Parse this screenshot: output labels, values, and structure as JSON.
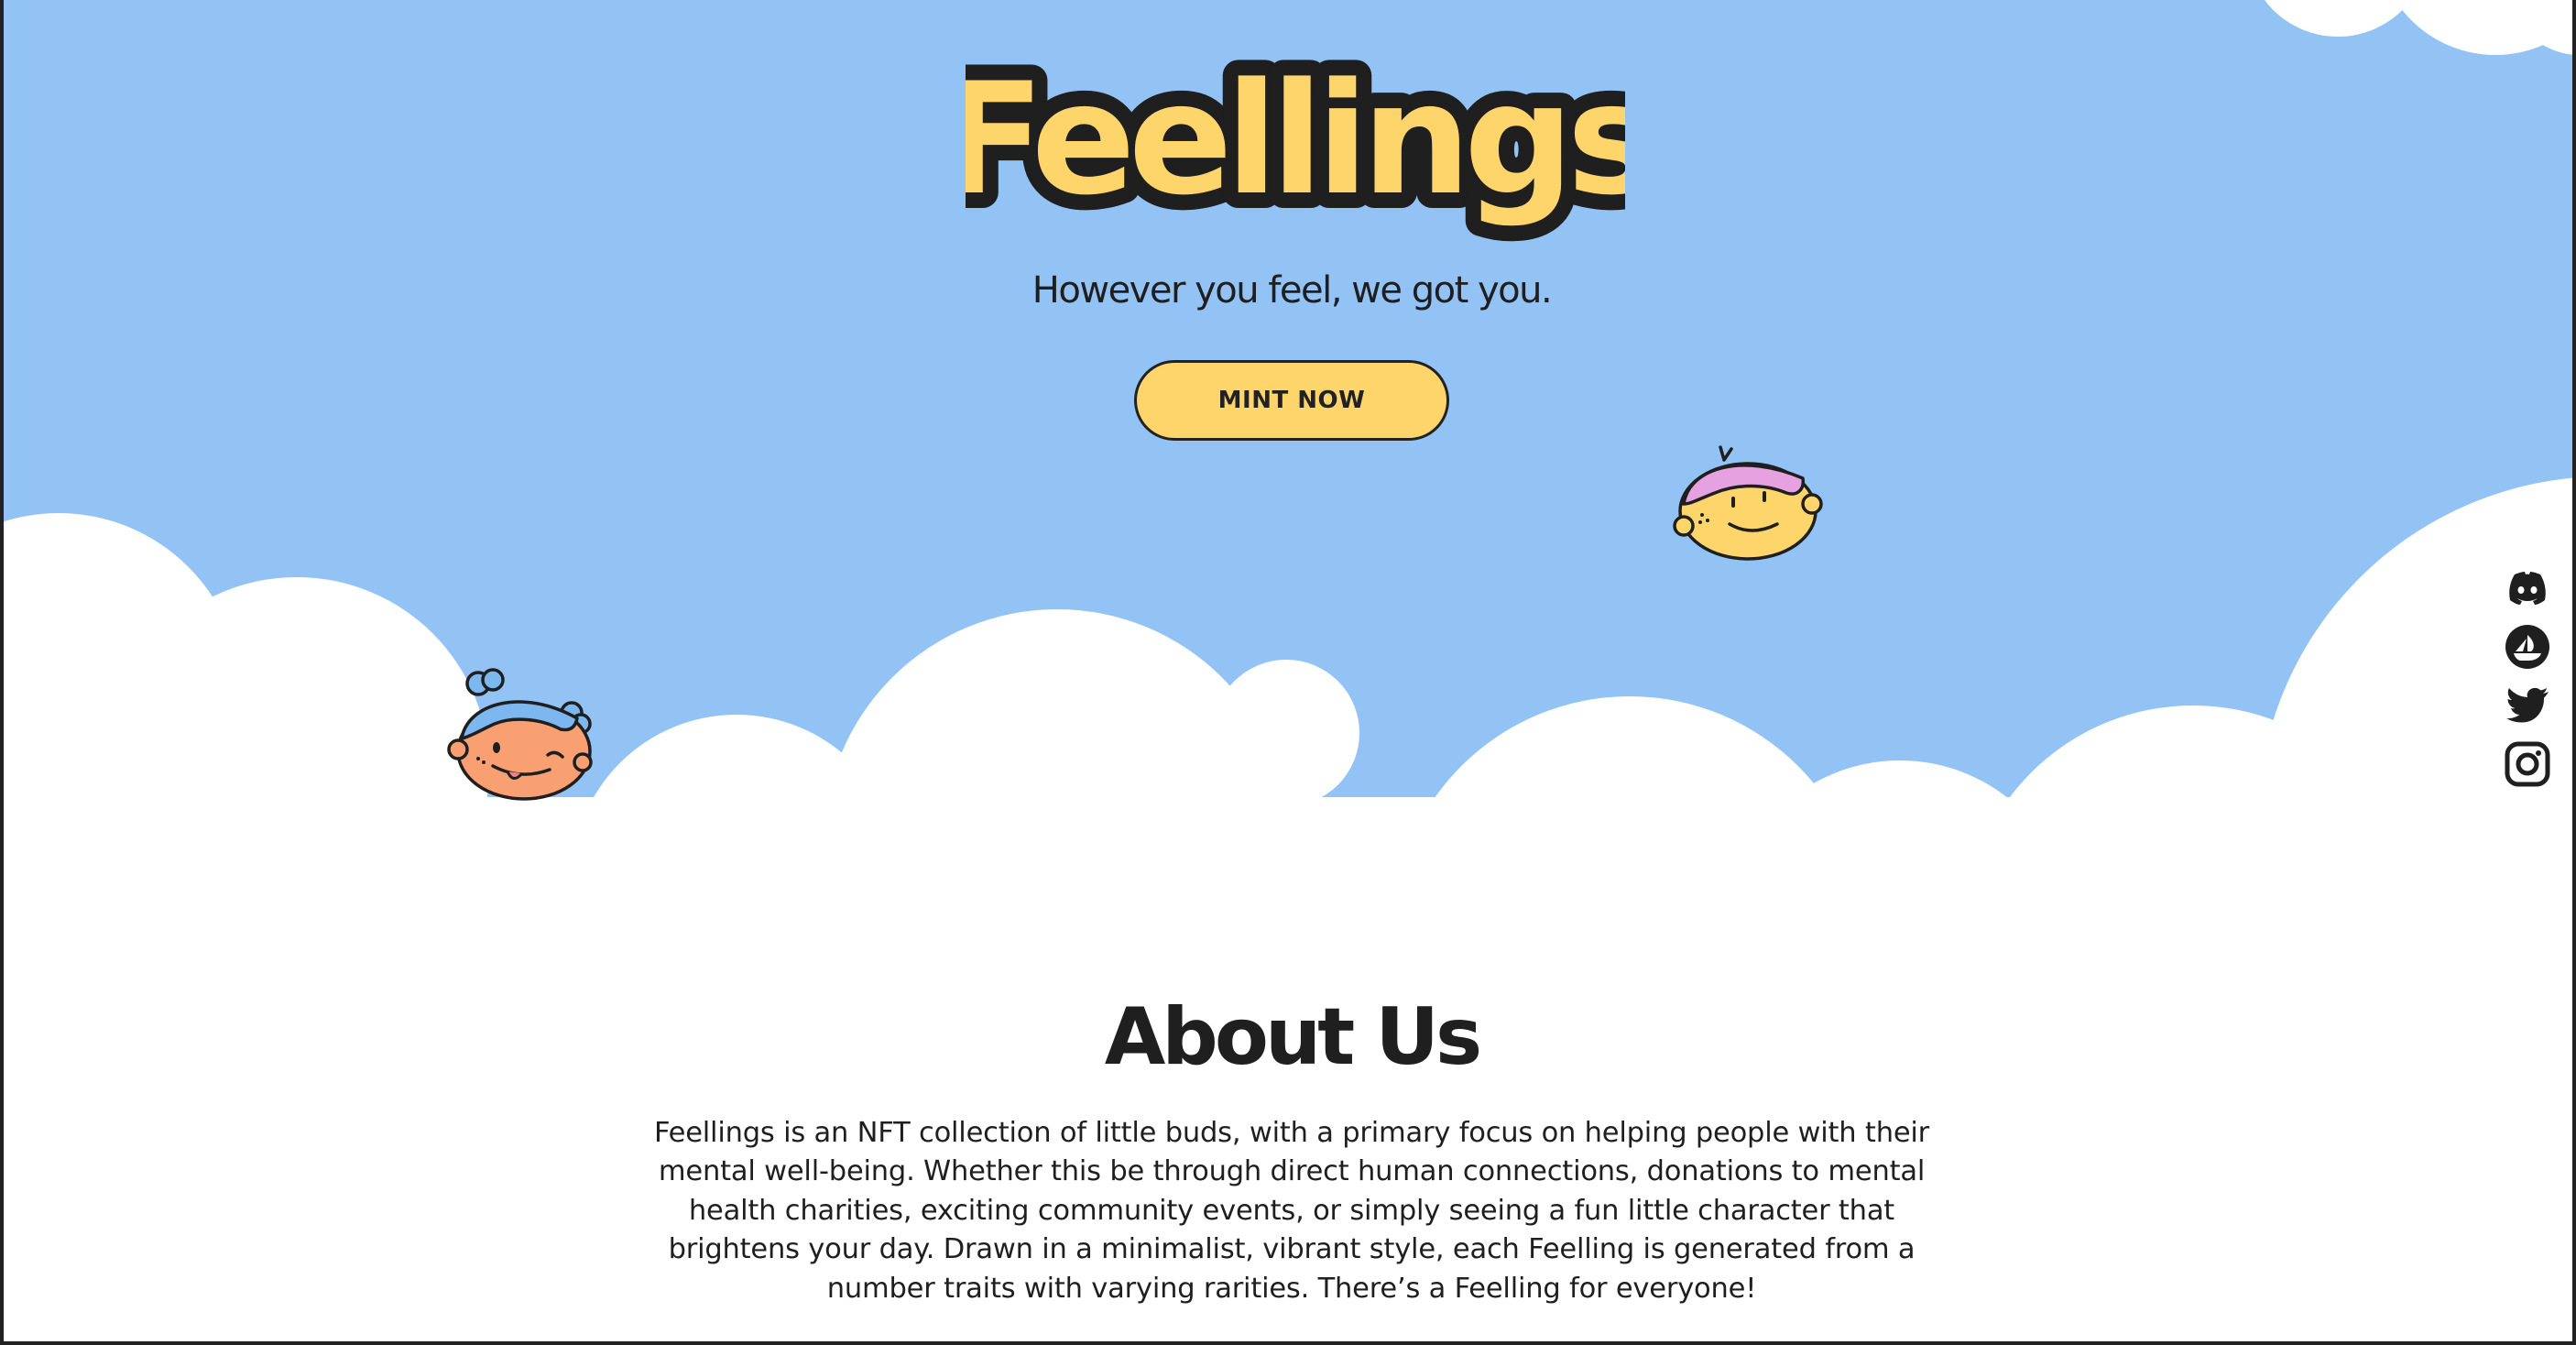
{
  "hero": {
    "logo_text": "Feellings",
    "tagline": "However you feel, we got you.",
    "mint_button_label": "MINT NOW"
  },
  "social": {
    "items": [
      {
        "name": "Discord",
        "icon": "discord-icon"
      },
      {
        "name": "OpenSea",
        "icon": "opensea-icon"
      },
      {
        "name": "Twitter",
        "icon": "twitter-icon"
      },
      {
        "name": "Instagram",
        "icon": "instagram-icon"
      }
    ]
  },
  "about": {
    "title": "About Us",
    "body": "Feellings is an NFT collection of little buds, with a primary focus on helping people with their mental well-being. Whether this be through direct human connections, donations to mental health charities, exciting community events, or simply seeing a fun little character that brightens your day. Drawn in a minimalist, vibrant style, each Feelling is generated from a number traits with varying rarities. There’s a Feelling for everyone!"
  },
  "colors": {
    "sky": "#93c3f5",
    "cloud": "#ffffff",
    "accent_yellow": "#fdd56a",
    "ink": "#1f1f1f",
    "hair_blue": "#7cb8ef",
    "face_orange": "#f8a071",
    "hair_pink": "#e5a1e0",
    "face_yellow": "#fdd56a"
  }
}
